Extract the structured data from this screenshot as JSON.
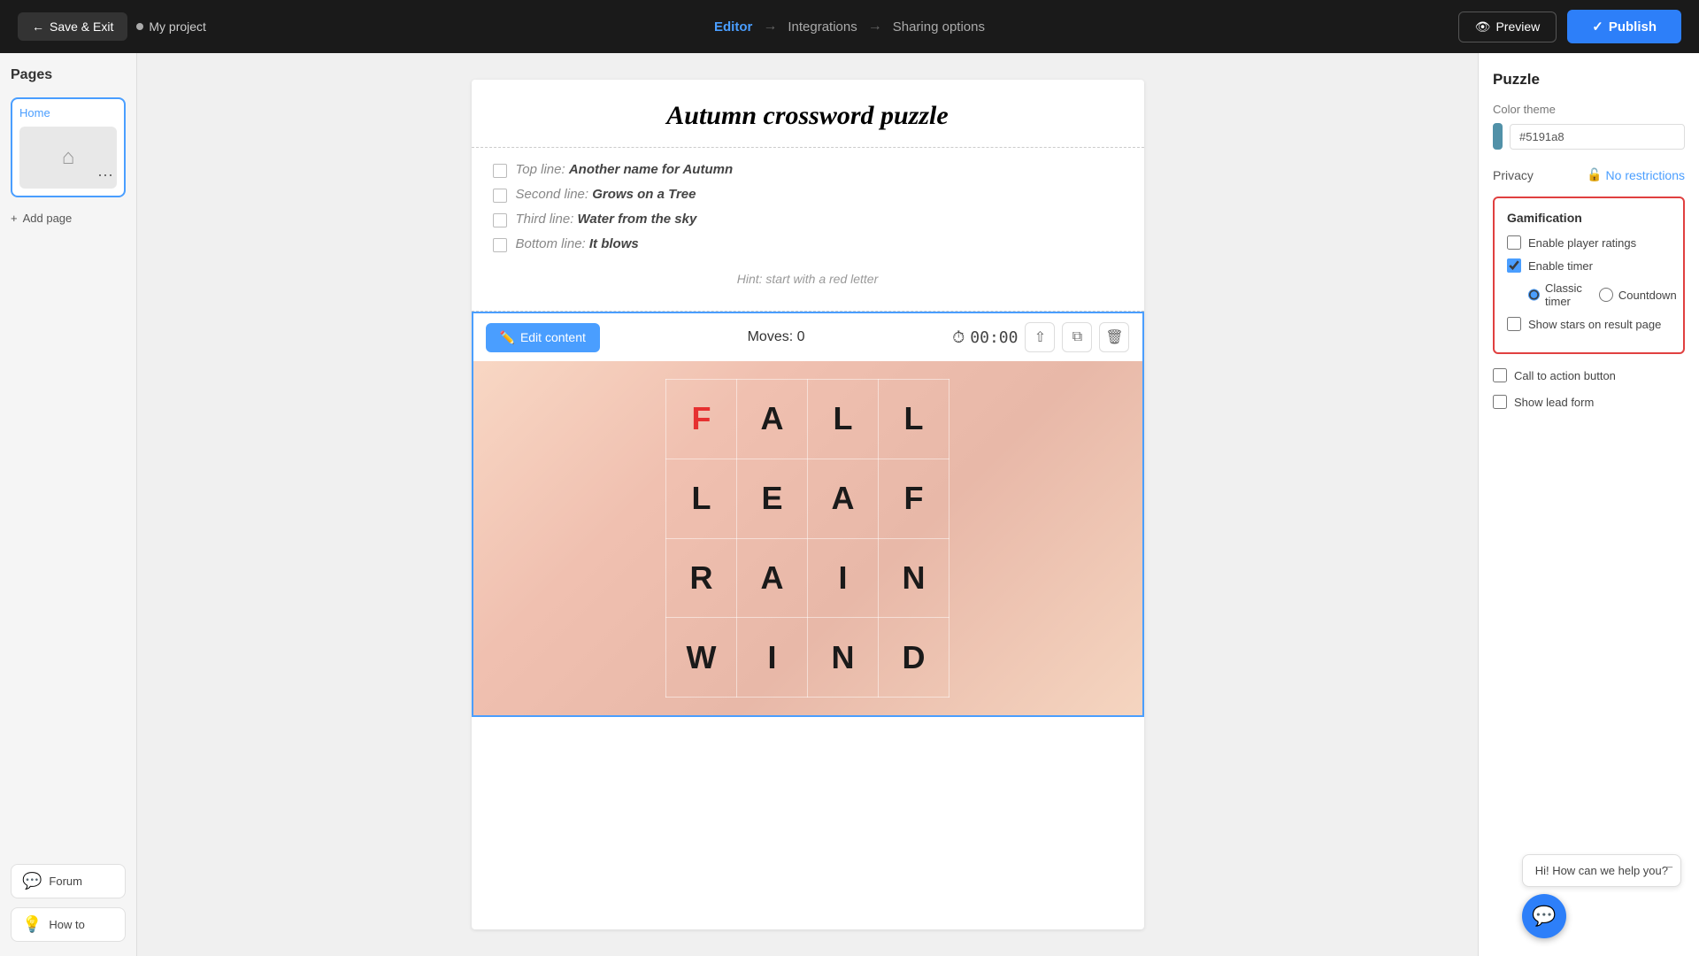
{
  "nav": {
    "save_exit_label": "Save & Exit",
    "project_name": "My project",
    "steps": [
      {
        "label": "Editor",
        "active": true
      },
      {
        "label": "Integrations",
        "active": false
      },
      {
        "label": "Sharing options",
        "active": false
      }
    ],
    "preview_label": "Preview",
    "publish_label": "Publish"
  },
  "sidebar": {
    "title": "Pages",
    "pages": [
      {
        "label": "Home"
      }
    ],
    "add_page_label": "Add page",
    "bottom_items": [
      {
        "label": "Forum",
        "icon": "💬"
      },
      {
        "label": "How to",
        "icon": "💡"
      }
    ]
  },
  "puzzle": {
    "title": "Autumn crossword puzzle",
    "clues": [
      {
        "position": "Top line:",
        "text": "Another name for Autumn"
      },
      {
        "position": "Second line:",
        "text": "Grows on a Tree"
      },
      {
        "position": "Third line:",
        "text": "Water from the sky"
      },
      {
        "position": "Bottom line:",
        "text": "It blows"
      }
    ],
    "hint": "Hint: start with a red letter",
    "edit_content_label": "Edit content",
    "moves_label": "Moves:",
    "moves_count": "0",
    "timer_display": "00:00",
    "grid": [
      [
        "F",
        "A",
        "L",
        "L"
      ],
      [
        "L",
        "E",
        "A",
        "F"
      ],
      [
        "R",
        "A",
        "I",
        "N"
      ],
      [
        "W",
        "I",
        "N",
        "D"
      ]
    ],
    "red_cell": {
      "row": 0,
      "col": 0
    }
  },
  "right_panel": {
    "title": "Puzzle",
    "color_theme_label": "Color theme",
    "color_value": "#5191a8",
    "privacy_label": "Privacy",
    "no_restrictions_label": "No restrictions",
    "gamification": {
      "title": "Gamification",
      "enable_player_ratings_label": "Enable player ratings",
      "enable_player_ratings_checked": false,
      "enable_timer_label": "Enable timer",
      "enable_timer_checked": true,
      "classic_timer_label": "Classic timer",
      "classic_timer_selected": true,
      "countdown_label": "Countdown",
      "countdown_selected": false,
      "show_stars_label": "Show stars on result page",
      "show_stars_checked": false
    },
    "call_to_action_label": "Call to action button",
    "show_lead_form_label": "Show lead form"
  },
  "chat": {
    "tooltip": "Hi! How can we help you?"
  }
}
